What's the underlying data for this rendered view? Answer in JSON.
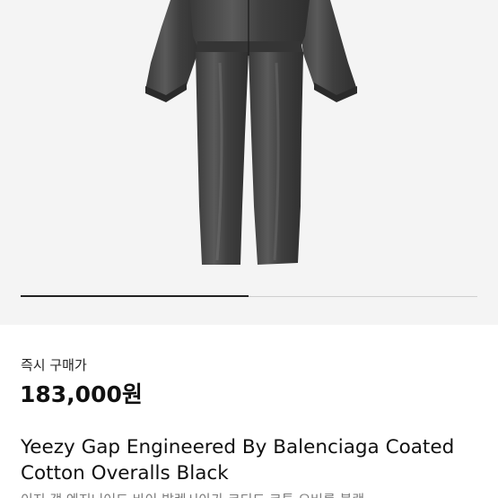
{
  "product": {
    "image_alt": "Black coated cotton overalls",
    "carousel": {
      "current_index": 0,
      "total": 2
    },
    "price_label": "즉시 구매가",
    "price": "183,000원",
    "title": "Yeezy Gap Engineered By Balenciaga Coated Cotton Overalls Black",
    "subtitle": "이지 갭 엔지니어드 바이 발렌시아가 코티드 코튼 오버롤 블랙"
  },
  "colors": {
    "image_background": "#f4f4f4",
    "garment": "#4a4a4a",
    "indicator_active": "#222222",
    "indicator_track": "#cfcfcf"
  }
}
